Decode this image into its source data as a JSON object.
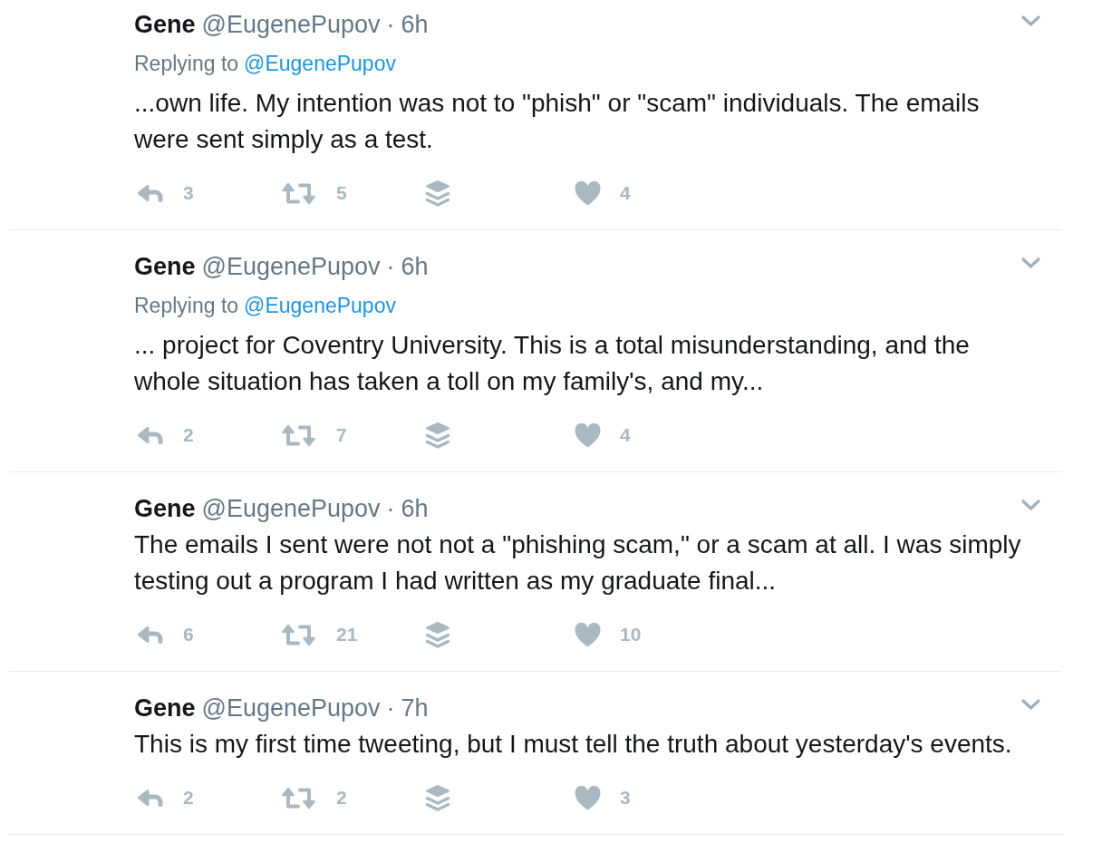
{
  "tweets": [
    {
      "name": "Gene",
      "handle": "@EugenePupov",
      "dot": "·",
      "time": "6h",
      "replying_label": "Replying to",
      "replying_handle": "@EugenePupov",
      "text": "...own life. My intention was not to \"phish\" or \"scam\" individuals. The emails were sent simply as a test.",
      "reply_count": "3",
      "retweet_count": "5",
      "like_count": "4"
    },
    {
      "name": "Gene",
      "handle": "@EugenePupov",
      "dot": "·",
      "time": "6h",
      "replying_label": "Replying to",
      "replying_handle": "@EugenePupov",
      "text": "... project for Coventry University. This is a total misunderstanding, and the whole situation has taken a toll on my family's, and my...",
      "reply_count": "2",
      "retweet_count": "7",
      "like_count": "4"
    },
    {
      "name": "Gene",
      "handle": "@EugenePupov",
      "dot": "·",
      "time": "6h",
      "text": "The emails I sent were not not a \"phishing scam,\" or a scam at all. I was simply testing out a program I had written as my graduate final...",
      "reply_count": "6",
      "retweet_count": "21",
      "like_count": "10"
    },
    {
      "name": "Gene",
      "handle": "@EugenePupov",
      "dot": "·",
      "time": "7h",
      "text": "This is my first time tweeting, but I must tell the truth about yesterday's events.",
      "reply_count": "2",
      "retweet_count": "2",
      "like_count": "3"
    }
  ]
}
